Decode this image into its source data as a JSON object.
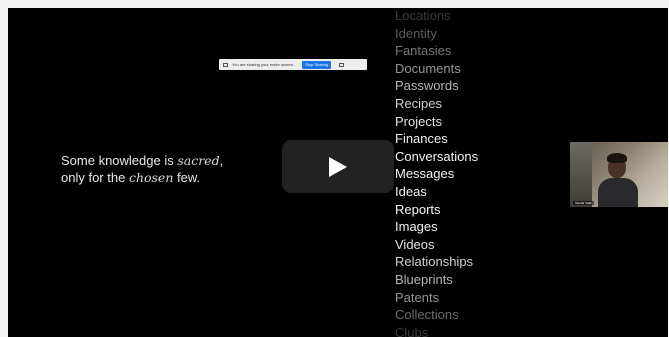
{
  "share_bar": {
    "message": "You are sharing your entire screen.",
    "stop_label": "Stop Sharing"
  },
  "quote": {
    "line1_prefix": "Some knowledge is ",
    "line1_emphasis": "sacred",
    "line1_suffix": ",",
    "line2_prefix": "only for the ",
    "line2_emphasis": "chosen",
    "line2_suffix": " few."
  },
  "word_list": [
    {
      "text": "Locations",
      "color": "#3a3a3a"
    },
    {
      "text": "Identity",
      "color": "#5a5a5a"
    },
    {
      "text": "Fantasies",
      "color": "#777777"
    },
    {
      "text": "Documents",
      "color": "#959595"
    },
    {
      "text": "Passwords",
      "color": "#b5b5b5"
    },
    {
      "text": "Recipes",
      "color": "#d0d0d0"
    },
    {
      "text": "Projects",
      "color": "#e2e2e2"
    },
    {
      "text": "Finances",
      "color": "#eeeeee"
    },
    {
      "text": "Conversations",
      "color": "#f4f4f4"
    },
    {
      "text": "Messages",
      "color": "#f4f4f4"
    },
    {
      "text": "Ideas",
      "color": "#f4f4f4"
    },
    {
      "text": "Reports",
      "color": "#f4f4f4"
    },
    {
      "text": "Images",
      "color": "#eeeeee"
    },
    {
      "text": "Videos",
      "color": "#e2e2e2"
    },
    {
      "text": "Relationships",
      "color": "#d0d0d0"
    },
    {
      "text": "Blueprints",
      "color": "#b5b5b5"
    },
    {
      "text": "Patents",
      "color": "#959595"
    },
    {
      "text": "Collections",
      "color": "#6a6a6a"
    },
    {
      "text": "Clubs",
      "color": "#3a3a3a"
    }
  ],
  "play_button": {
    "icon": "play-icon",
    "color": "#ffffff"
  },
  "webcam": {
    "name_tag": "Vendar Valik"
  }
}
